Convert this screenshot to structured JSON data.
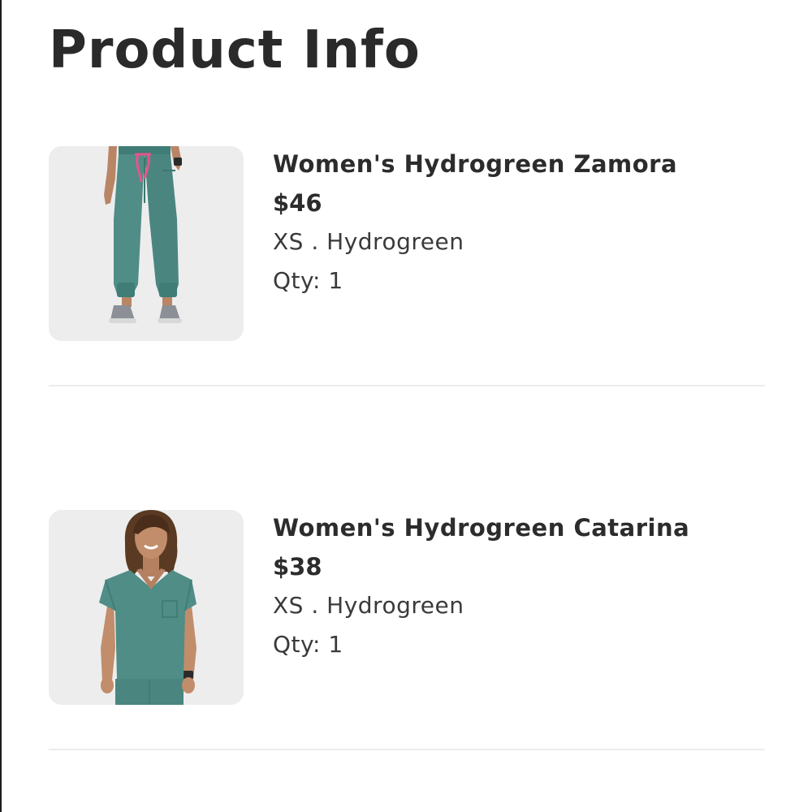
{
  "page": {
    "title": "Product Info"
  },
  "products": [
    {
      "name": "Women's Hydrogreen Zamora",
      "price": "$46",
      "variant": "XS . Hydrogreen",
      "qty": "Qty: 1",
      "image_icon": "scrub-pants-image",
      "garment_color": "#4f8d86",
      "accent_color": "#e6548b"
    },
    {
      "name": "Women's Hydrogreen Catarina",
      "price": "$38",
      "variant": "XS . Hydrogreen",
      "qty": "Qty: 1",
      "image_icon": "scrub-top-image",
      "garment_color": "#4f8d86"
    }
  ],
  "colors": {
    "text": "#2c2c2c",
    "thumb_background": "#ededee",
    "divider": "#ececec"
  }
}
